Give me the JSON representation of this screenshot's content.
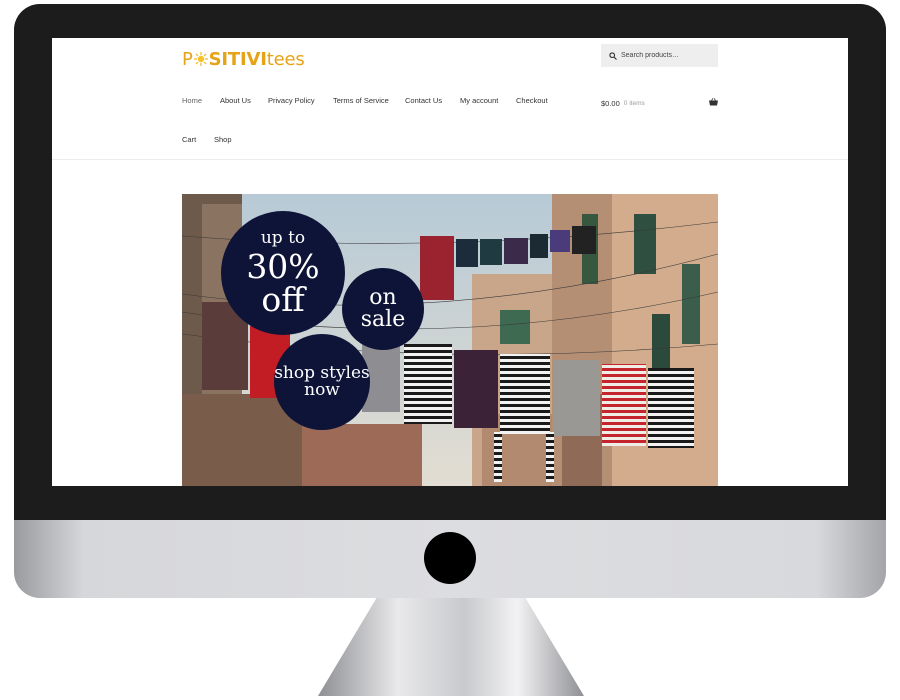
{
  "brand": {
    "logo_prefix": "P",
    "logo_middle": "SITIVI",
    "logo_suffix": "tees",
    "accent": "#e6a317"
  },
  "search": {
    "placeholder": "Search products…",
    "icon": "search-icon"
  },
  "nav": {
    "items": [
      {
        "label": "Home",
        "active": true
      },
      {
        "label": "About Us"
      },
      {
        "label": "Privacy Policy"
      },
      {
        "label": "Terms of Service"
      },
      {
        "label": "Contact Us"
      },
      {
        "label": "My account"
      },
      {
        "label": "Checkout"
      },
      {
        "label": "Cart"
      },
      {
        "label": "Shop"
      }
    ]
  },
  "cart": {
    "amount": "$0.00",
    "items": "0 items",
    "icon": "basket-icon"
  },
  "hero": {
    "badge1": {
      "top": "up to",
      "mid": "30%",
      "bot": "off"
    },
    "badge2": {
      "top": "on",
      "bot": "sale"
    },
    "badge3": {
      "top": "shop styles",
      "bot": "now"
    },
    "badge_color": "#0e1438"
  },
  "colors": {
    "bezel": "#1c1c1c",
    "link": "#333333"
  }
}
